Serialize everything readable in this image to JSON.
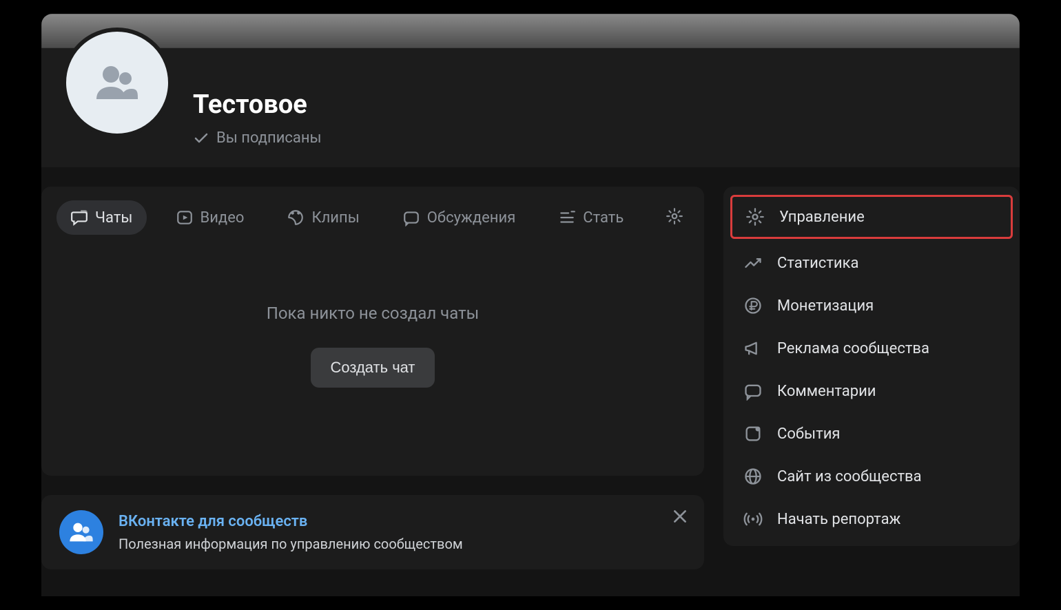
{
  "header": {
    "title": "Тестовое",
    "subscribed_label": "Вы подписаны"
  },
  "tabs": {
    "items": [
      {
        "label": "Чаты",
        "icon": "chat-icon",
        "active": true
      },
      {
        "label": "Видео",
        "icon": "play-icon",
        "active": false
      },
      {
        "label": "Клипы",
        "icon": "clips-icon",
        "active": false
      },
      {
        "label": "Обсуждения",
        "icon": "discussion-icon",
        "active": false
      },
      {
        "label": "Стать",
        "icon": "article-icon",
        "active": false
      }
    ]
  },
  "empty_state": {
    "text": "Пока никто не создал чаты",
    "button": "Создать чат"
  },
  "promo": {
    "title": "ВКонтакте для сообществ",
    "subtitle": "Полезная информация по управлению сообществом"
  },
  "sidebar": {
    "items": [
      {
        "label": "Управление",
        "icon": "gear-icon",
        "highlighted": true
      },
      {
        "label": "Статистика",
        "icon": "stats-icon"
      },
      {
        "label": "Монетизация",
        "icon": "ruble-icon"
      },
      {
        "label": "Реклама сообщества",
        "icon": "megaphone-icon"
      },
      {
        "label": "Комментарии",
        "icon": "comment-icon"
      },
      {
        "label": "События",
        "icon": "notification-icon"
      },
      {
        "label": "Сайт из сообщества",
        "icon": "globe-icon"
      },
      {
        "label": "Начать репортаж",
        "icon": "broadcast-icon"
      }
    ]
  }
}
